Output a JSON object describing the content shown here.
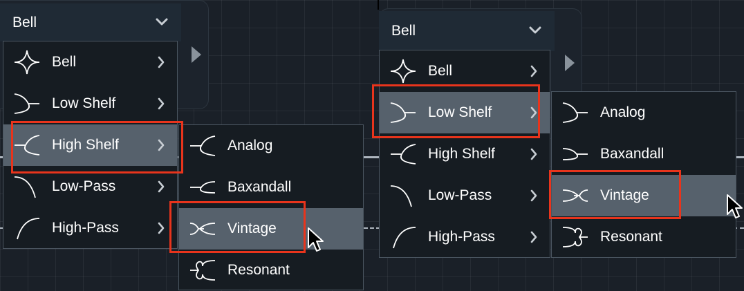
{
  "colors": {
    "accent_box": "#e8341c",
    "highlight": "#56616c",
    "menu_bg": "#161c22"
  },
  "left": {
    "selector": {
      "value": "Bell"
    },
    "menu": [
      {
        "label": "Bell",
        "icon": "bell-curve-icon"
      },
      {
        "label": "Low Shelf",
        "icon": "low-shelf-icon"
      },
      {
        "label": "High Shelf",
        "icon": "high-shelf-icon"
      },
      {
        "label": "Low-Pass",
        "icon": "low-pass-icon"
      },
      {
        "label": "High-Pass",
        "icon": "high-pass-icon"
      }
    ],
    "submenu": [
      {
        "label": "Analog",
        "icon": "analog-icon"
      },
      {
        "label": "Baxandall",
        "icon": "baxandall-icon"
      },
      {
        "label": "Vintage",
        "icon": "vintage-icon"
      },
      {
        "label": "Resonant",
        "icon": "resonant-icon"
      }
    ]
  },
  "right": {
    "selector": {
      "value": "Bell"
    },
    "menu": [
      {
        "label": "Bell",
        "icon": "bell-curve-icon"
      },
      {
        "label": "Low Shelf",
        "icon": "low-shelf-icon"
      },
      {
        "label": "High Shelf",
        "icon": "high-shelf-icon"
      },
      {
        "label": "Low-Pass",
        "icon": "low-pass-icon"
      },
      {
        "label": "High-Pass",
        "icon": "high-pass-icon"
      }
    ],
    "submenu": [
      {
        "label": "Analog",
        "icon": "analog-icon"
      },
      {
        "label": "Baxandall",
        "icon": "baxandall-icon"
      },
      {
        "label": "Vintage",
        "icon": "vintage-icon"
      },
      {
        "label": "Resonant",
        "icon": "resonant-icon"
      }
    ]
  }
}
